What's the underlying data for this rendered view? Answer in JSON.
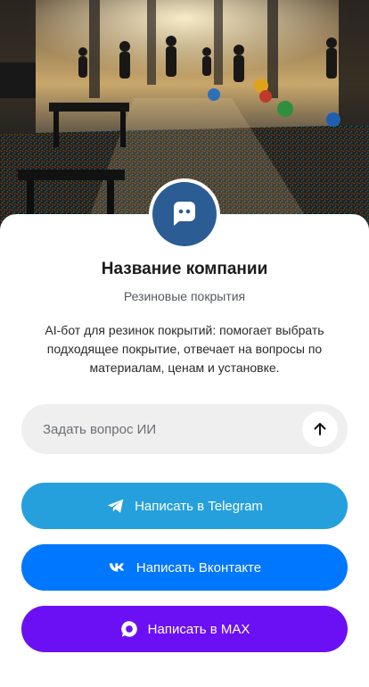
{
  "company": {
    "name": "Название компании",
    "category": "Резиновые покрытия",
    "description": "AI-бот для резинок покрытий: помогает выбрать подходящее покрытие, отвечает на вопросы по материалам, ценам и установке."
  },
  "ask": {
    "placeholder": "Задать вопрос ИИ",
    "send_icon": "arrow-up-icon"
  },
  "buttons": {
    "telegram": {
      "label": "Написать в Telegram",
      "icon": "telegram-icon",
      "color": "#25a0dd"
    },
    "vk": {
      "label": "Написать Вконтакте",
      "icon": "vk-icon",
      "color": "#0077ff"
    },
    "max": {
      "label": "Написать в MAX",
      "icon": "max-icon",
      "color": "#6b10f5"
    }
  },
  "colors": {
    "avatar": "#2b5d94",
    "ask_background": "#efefef"
  }
}
